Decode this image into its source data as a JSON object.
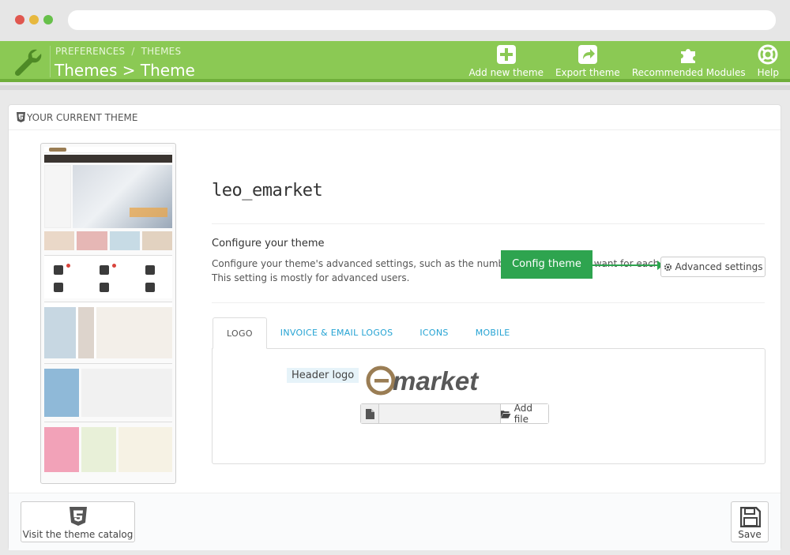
{
  "header": {
    "breadcrumb": [
      "PREFERENCES",
      "THEMES"
    ],
    "breadcrumb_sep": "/",
    "title": "Themes > Theme",
    "toolbar": [
      {
        "label": "Add new theme",
        "icon": "plus-square-icon"
      },
      {
        "label": "Export theme",
        "icon": "share-square-icon"
      },
      {
        "label": "Recommended Modules",
        "icon": "puzzle-icon"
      },
      {
        "label": "Help",
        "icon": "lifebuoy-icon"
      }
    ]
  },
  "panel": {
    "title": "YOUR CURRENT THEME",
    "theme_name": "leo_emarket",
    "configure": {
      "title": "Configure your theme",
      "description": "Configure your theme's advanced settings, such as the number of products you want for each page. This setting is mostly for advanced users.",
      "callout": "Config theme",
      "advanced_button": "Advanced settings"
    },
    "tabs": [
      {
        "label": "LOGO",
        "active": true
      },
      {
        "label": "INVOICE & EMAIL LOGOS",
        "active": false
      },
      {
        "label": "ICONS",
        "active": false
      },
      {
        "label": "MOBILE",
        "active": false
      }
    ],
    "logo": {
      "label": "Header logo",
      "logo_text": "market",
      "file_value": "",
      "add_file": "Add file"
    },
    "footer": {
      "catalog_button": "Visit the theme catalog",
      "save_button": "Save"
    }
  },
  "colors": {
    "header_green": "#8bc954",
    "callout_green": "#2ea44f",
    "link_blue": "#25a3d3",
    "logo_brown": "#9a7d54"
  }
}
